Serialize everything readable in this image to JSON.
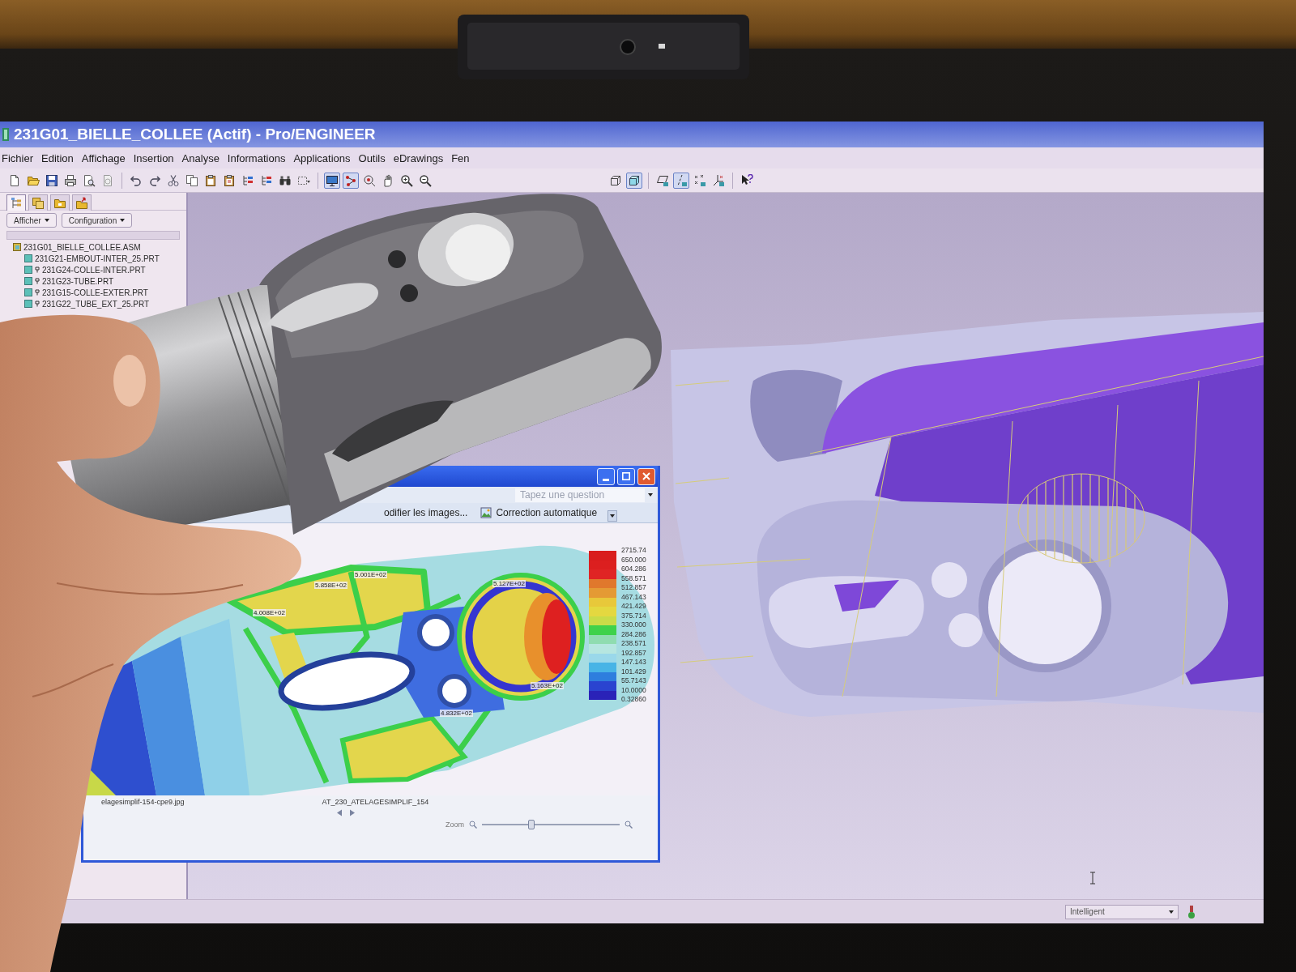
{
  "window": {
    "title": "231G01_BIELLE_COLLEE (Actif) - Pro/ENGINEER"
  },
  "menu": [
    {
      "label": "Fichier"
    },
    {
      "label": "Edition"
    },
    {
      "label": "Affichage"
    },
    {
      "label": "Insertion"
    },
    {
      "label": "Analyse"
    },
    {
      "label": "Informations"
    },
    {
      "label": "Applications"
    },
    {
      "label": "Outils"
    },
    {
      "label": "eDrawings"
    },
    {
      "label": "Fen"
    }
  ],
  "toolbar": {
    "view_toggles": [
      {
        "on": true
      },
      {
        "on": true
      }
    ],
    "display_styles": [
      {
        "selected": false
      },
      {
        "selected": true
      }
    ],
    "datum_toggles": [
      {
        "on": false
      },
      {
        "on": true
      },
      {
        "on": false
      },
      {
        "on": false
      }
    ]
  },
  "navigator": {
    "tabs": [
      {
        "selected": true
      },
      {
        "selected": false
      },
      {
        "selected": false
      },
      {
        "selected": false
      }
    ],
    "buttons": [
      {
        "label": "Afficher"
      },
      {
        "label": "Configuration"
      }
    ],
    "model_tree": {
      "label": "231G01_BIELLE_COLLEE.ASM",
      "children": [
        {
          "label": "231G21-EMBOUT-INTER_25.PRT",
          "marked": false
        },
        {
          "label": "231G24-COLLE-INTER.PRT",
          "marked": true
        },
        {
          "label": "231G23-TUBE.PRT",
          "marked": true
        },
        {
          "label": "231G15-COLLE-EXTER.PRT",
          "marked": true
        },
        {
          "label": "231G22_TUBE_EXT_25.PRT",
          "marked": true
        }
      ]
    }
  },
  "image_viewer": {
    "question_field": {
      "placeholder": "Tapez une question"
    },
    "toolbar": [
      {
        "label": "odifier les images..."
      },
      {
        "label": "Correction automatique"
      }
    ],
    "plot": {
      "annotations": [
        "5.001E+02",
        "5.858E+02",
        "4.008E+02",
        "5.127E+02",
        "5.163E+02",
        "4.832E+02"
      ],
      "legend_labels": [
        "2715.74",
        "650.000",
        "604.286",
        "558.571",
        "512.857",
        "467.143",
        "421.429",
        "375.714",
        "330.000",
        "284.286",
        "238.571",
        "192.857",
        "147.143",
        "101.429",
        "55.7143",
        "10.0000",
        "0.32860"
      ],
      "legend_bands": [
        {
          "color": "#d91d1d"
        },
        {
          "color": "#dc1f1f"
        },
        {
          "color": "#e02424"
        },
        {
          "color": "#e0782c"
        },
        {
          "color": "#e49a34"
        },
        {
          "color": "#e8c83a"
        },
        {
          "color": "#e4d840"
        },
        {
          "color": "#c8dc48"
        },
        {
          "color": "#3ed24a"
        },
        {
          "color": "#8fdcb0"
        },
        {
          "color": "#b6e6e0"
        },
        {
          "color": "#9ad8ea"
        },
        {
          "color": "#48b4e6"
        },
        {
          "color": "#2e7ede"
        },
        {
          "color": "#2a44d0"
        },
        {
          "color": "#2a22b8"
        }
      ]
    },
    "file_names": [
      "elagesimplif-154-cpe9.jpg",
      "AT_230_ATELAGESIMPLIF_154"
    ],
    "zoom": {
      "label": "Zoom",
      "level": 0.36
    }
  },
  "status_bar": {
    "filter": "Intelligent"
  }
}
